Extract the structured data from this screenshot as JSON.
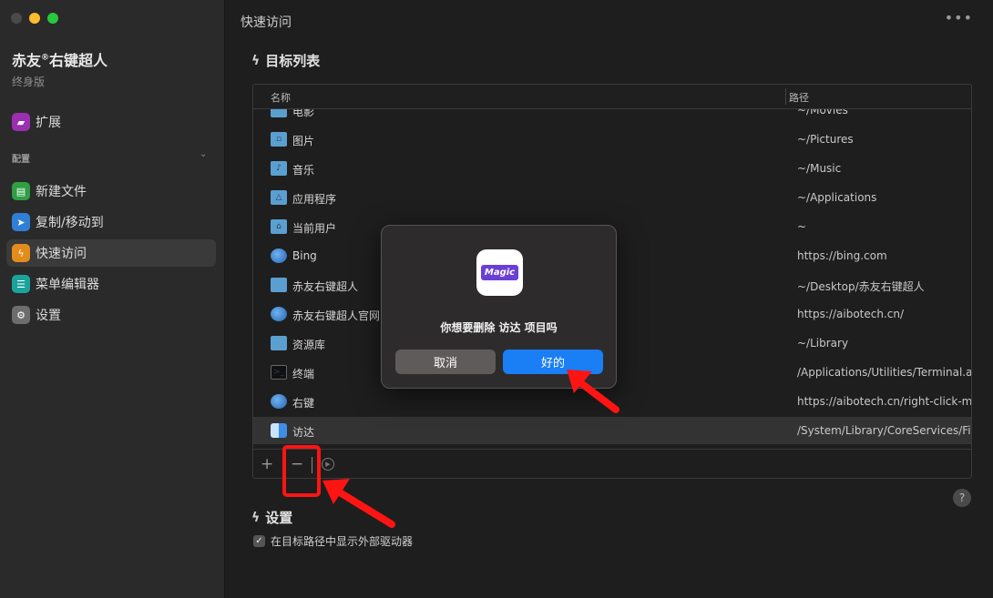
{
  "app": {
    "name": "赤友",
    "name_mark": "®",
    "name_suffix": "右键超人",
    "edition": "终身版"
  },
  "sidebar": {
    "extension_label": "扩展",
    "section_label": "配置",
    "items": [
      {
        "label": "新建文件",
        "icon": "new-file-icon"
      },
      {
        "label": "复制/移动到",
        "icon": "copy-move-icon"
      },
      {
        "label": "快速访问",
        "icon": "quick-access-icon",
        "active": true
      },
      {
        "label": "菜单编辑器",
        "icon": "menu-editor-icon"
      },
      {
        "label": "设置",
        "icon": "settings-icon"
      }
    ]
  },
  "main": {
    "window_title": "快速访问",
    "more_label": "•••",
    "targets_title": "目标列表",
    "table": {
      "col_name": "名称",
      "col_path": "路径",
      "rows": [
        {
          "name": "电影",
          "path": "~/Movies",
          "icon": "folder"
        },
        {
          "name": "图片",
          "path": "~/Pictures",
          "icon": "folder"
        },
        {
          "name": "音乐",
          "path": "~/Music",
          "icon": "folder"
        },
        {
          "name": "应用程序",
          "path": "~/Applications",
          "icon": "folder"
        },
        {
          "name": "当前用户",
          "path": "~",
          "icon": "folder"
        },
        {
          "name": "Bing",
          "path": "https://bing.com",
          "icon": "globe"
        },
        {
          "name": "赤友右键超人",
          "path": "~/Desktop/赤友右键超人",
          "icon": "folder"
        },
        {
          "name": "赤友右键超人官网",
          "path": "https://aibotech.cn/",
          "icon": "globe"
        },
        {
          "name": "资源库",
          "path": "~/Library",
          "icon": "folder"
        },
        {
          "name": "终端",
          "path": "/Applications/Utilities/Terminal.app",
          "icon": "terminal"
        },
        {
          "name": "右键",
          "path": "https://aibotech.cn/right-click-menu",
          "icon": "globe"
        },
        {
          "name": "访达",
          "path": "/System/Library/CoreServices/Finder.app",
          "icon": "finder",
          "selected": true
        }
      ]
    },
    "toolbar": {
      "add": "+",
      "remove": "−"
    },
    "settings_title": "设置",
    "show_external_drives": "在目标路径中显示外部驱动器",
    "help": "?"
  },
  "dialog": {
    "icon_text": "Magic",
    "message": "你想要删除 访达 项目吗",
    "cancel": "取消",
    "ok": "好的"
  },
  "colors": {
    "accent": "#1a7ef5",
    "annotation": "#ff1414"
  }
}
